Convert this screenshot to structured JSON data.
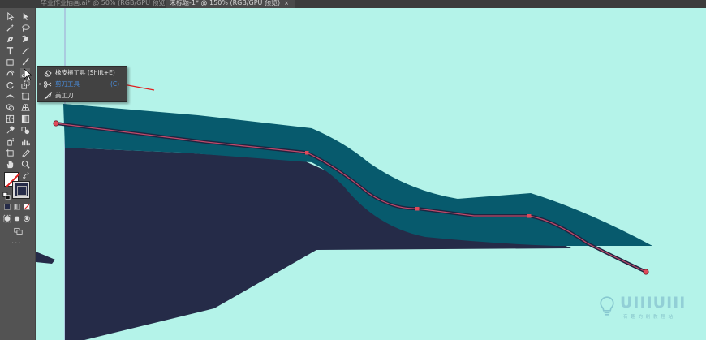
{
  "tabs": [
    {
      "label": "毕业作业插画.ai* @ 50% (RGB/GPU 预览)",
      "active": false
    },
    {
      "label": "未标题-1* @ 150% (RGB/GPU 预览)",
      "active": true
    }
  ],
  "tab_close_glyph": "×",
  "toolbar": {
    "tools": [
      "selection-tool",
      "direct-selection-tool",
      "magic-wand-tool",
      "lasso-tool",
      "pen-tool",
      "curvature-tool",
      "type-tool",
      "line-segment-tool",
      "rectangle-tool",
      "paintbrush-tool",
      "shaper-tool",
      "scissors-tool",
      "rotate-tool",
      "scale-tool",
      "width-tool",
      "free-transform-tool",
      "shape-builder-tool",
      "perspective-grid-tool",
      "mesh-tool",
      "gradient-tool",
      "eyedropper-tool",
      "blend-tool",
      "symbol-sprayer-tool",
      "column-graph-tool",
      "artboard-tool",
      "slice-tool",
      "hand-tool",
      "zoom-tool"
    ],
    "more_label": "···"
  },
  "flyout": {
    "items": [
      {
        "label": "橡皮擦工具 (Shift+E)",
        "icon": "eraser-icon",
        "shortcut": "",
        "active": false
      },
      {
        "label": "剪刀工具",
        "icon": "scissors-icon",
        "shortcut": "(C)",
        "active": true
      },
      {
        "label": "美工刀",
        "icon": "knife-icon",
        "shortcut": "",
        "active": false
      }
    ],
    "active_bullet": "•"
  },
  "canvas": {
    "background": "#b4f3e9",
    "colors": {
      "dark_navy": "#252b48",
      "teal": "#075a6d",
      "path_stroke": "#c04a6a",
      "anchor": "#e04a5a",
      "arrow": "#e02020"
    }
  },
  "watermark": {
    "text": "UIIIUIII",
    "subtitle": "有 趣 的 刷 教 程 站"
  }
}
